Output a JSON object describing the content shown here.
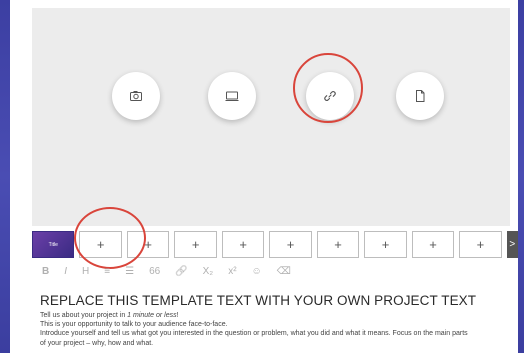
{
  "media": {
    "buttons": [
      {
        "id": "photo",
        "icon": "camera-icon"
      },
      {
        "id": "video",
        "icon": "video-icon"
      },
      {
        "id": "link",
        "icon": "link-icon"
      },
      {
        "id": "file",
        "icon": "file-icon"
      }
    ]
  },
  "thumbnails": {
    "first_label": "Title",
    "add_labels": [
      "+",
      "+",
      "+",
      "+",
      "+",
      "+",
      "+",
      "+",
      "+"
    ],
    "next_arrow": ">"
  },
  "toolbar": {
    "bold": "B",
    "italic": "I",
    "heading": "H",
    "align": "≡",
    "list": "☰",
    "quote": "66",
    "link": "🔗",
    "subscript": "X₂",
    "superscript": "x²",
    "emoji": "☺",
    "clear": "⌫"
  },
  "content": {
    "heading": "REPLACE THIS TEMPLATE TEXT WITH YOUR OWN PROJECT TEXT",
    "line1_prefix": "Tell us about your project in ",
    "line1_em": "1 minute or less",
    "line1_suffix": "!",
    "line2": "This is your opportunity to talk to your audience face-to-face.",
    "line3": "Introduce yourself and tell us what got you interested in the question or problem, what you did and what it means. Focus on the main parts",
    "line4": "of your project – why, how and what."
  },
  "colors": {
    "highlight": "#d9453b",
    "background": "#3c3fa2"
  }
}
